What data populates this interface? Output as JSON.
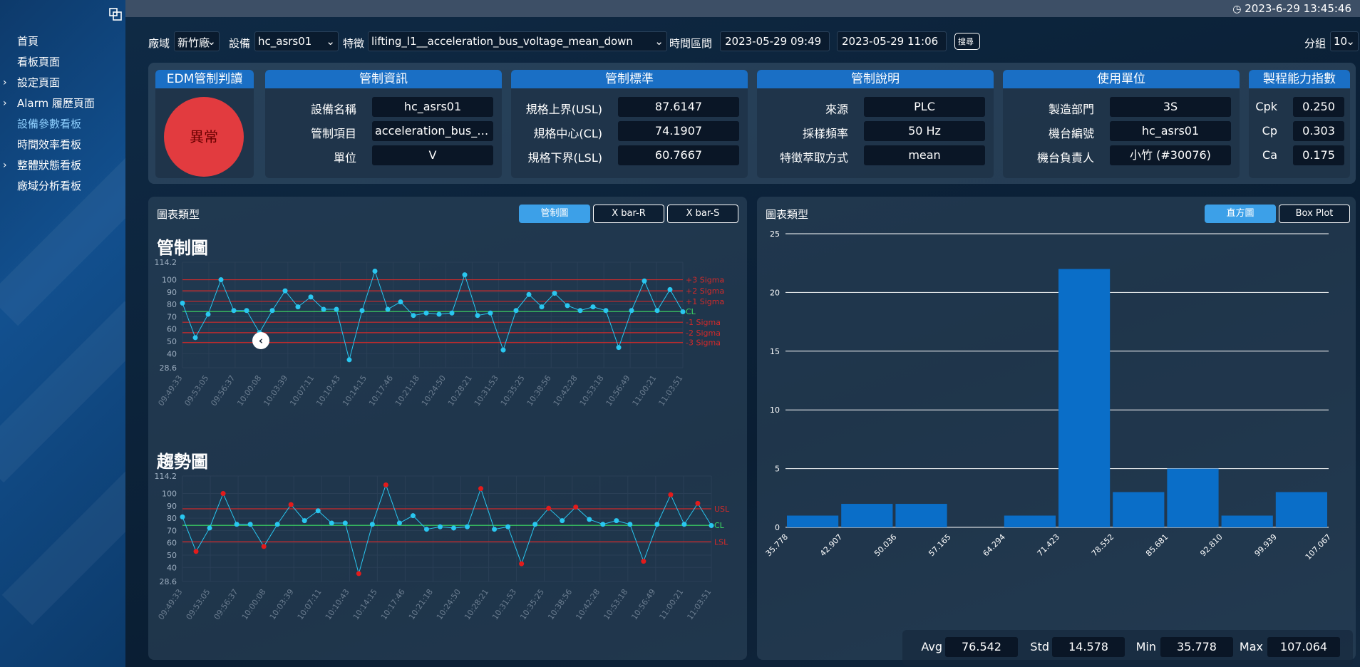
{
  "clock": "2023-6-29 13:45:46",
  "nav": {
    "items": [
      {
        "label": "首頁",
        "expandable": false
      },
      {
        "label": "看板頁面",
        "expandable": false
      },
      {
        "label": "設定頁面",
        "expandable": true
      },
      {
        "label": "Alarm 履歷頁面",
        "expandable": true
      },
      {
        "label": "設備參數看板",
        "expandable": false,
        "active": true
      },
      {
        "label": "時間效率看板",
        "expandable": false
      },
      {
        "label": "整體狀態看板",
        "expandable": true
      },
      {
        "label": "廠域分析看板",
        "expandable": false
      }
    ]
  },
  "filters": {
    "site_label": "廠域",
    "site_value": "新竹廠",
    "device_label": "設備",
    "device_value": "hc_asrs01",
    "feature_label": "特徵",
    "feature_value": "lifting_l1__acceleration_bus_voltage_mean_down",
    "time_label": "時間區間",
    "start": "2023-05-29 09:49",
    "end": "2023-05-29 11:06",
    "search": "搜尋",
    "group_label": "分組",
    "group_value": "10"
  },
  "edm": {
    "title": "EDM管制判讀",
    "status": "異常"
  },
  "control_info": {
    "title": "管制資訊",
    "rows": [
      {
        "k": "設備名稱",
        "v": "hc_asrs01"
      },
      {
        "k": "管制項目",
        "v": "acceleration_bus_voltage_mean_down"
      },
      {
        "k": "單位",
        "v": "V"
      }
    ]
  },
  "control_std": {
    "title": "管制標準",
    "rows": [
      {
        "k": "規格上界(USL)",
        "v": "87.6147"
      },
      {
        "k": "規格中心(CL)",
        "v": "74.1907"
      },
      {
        "k": "規格下界(LSL)",
        "v": "60.7667"
      }
    ]
  },
  "control_desc": {
    "title": "管制說明",
    "rows": [
      {
        "k": "來源",
        "v": "PLC"
      },
      {
        "k": "採樣頻率",
        "v": "50 Hz"
      },
      {
        "k": "特徵萃取方式",
        "v": "mean"
      }
    ]
  },
  "unit_info": {
    "title": "使用單位",
    "rows": [
      {
        "k": "製造部門",
        "v": "3S"
      },
      {
        "k": "機台編號",
        "v": "hc_asrs01"
      },
      {
        "k": "機台負責人",
        "v": "小竹 (#30076)"
      }
    ]
  },
  "capability": {
    "title": "製程能力指數",
    "rows": [
      {
        "k": "Cpk",
        "v": "0.250"
      },
      {
        "k": "Cp",
        "v": "0.303"
      },
      {
        "k": "Ca",
        "v": "0.175"
      }
    ]
  },
  "left_panel": {
    "type_label": "圖表類型",
    "buttons": [
      "管制圖",
      "X bar-R",
      "X bar-S"
    ],
    "active": 0,
    "control_title": "管制圖",
    "trend_title": "趨勢圖"
  },
  "right_panel": {
    "type_label": "圖表類型",
    "buttons": [
      "直方圖",
      "Box Plot"
    ],
    "active": 0
  },
  "stats": [
    {
      "k": "Avg",
      "v": "76.542"
    },
    {
      "k": "Std",
      "v": "14.578"
    },
    {
      "k": "Min",
      "v": "35.778"
    },
    {
      "k": "Max",
      "v": "107.064"
    }
  ],
  "chart_data": [
    {
      "type": "line",
      "title": "管制圖",
      "ylim": [
        28.6,
        114.2
      ],
      "y_ticks": [
        "114.2",
        "100",
        "90",
        "80",
        "70",
        "60",
        "50",
        "40",
        "28.6"
      ],
      "x_ticks": [
        "09:49:33",
        "09:53:05",
        "09:56:37",
        "10:00:08",
        "10:03:39",
        "10:07:11",
        "10:10:43",
        "10:14:15",
        "10:17:46",
        "10:21:18",
        "10:24:50",
        "10:28:21",
        "10:31:53",
        "10:35:25",
        "10:38:56",
        "10:42:28",
        "10:53:18",
        "10:56:49",
        "11:00:21",
        "11:03:51"
      ],
      "values": [
        81,
        53,
        72,
        100,
        75,
        75,
        57,
        75,
        91,
        78,
        86,
        76,
        76,
        35,
        75,
        107,
        76,
        82,
        71,
        73,
        72,
        73,
        104,
        71,
        73,
        43,
        75,
        88,
        78,
        89,
        79,
        75,
        78,
        75,
        45,
        75,
        99,
        75,
        92,
        74
      ],
      "lines": [
        {
          "label": "+3 Sigma",
          "value": 100,
          "color": "#d12a2a"
        },
        {
          "label": "+2 Sigma",
          "value": 91,
          "color": "#d12a2a"
        },
        {
          "label": "+1 Sigma",
          "value": 82.5,
          "color": "#d12a2a"
        },
        {
          "label": "CL",
          "value": 74.19,
          "color": "#3ddc64"
        },
        {
          "label": "-1 Sigma",
          "value": 65.5,
          "color": "#d12a2a"
        },
        {
          "label": "-2 Sigma",
          "value": 57,
          "color": "#d12a2a"
        },
        {
          "label": "-3 Sigma",
          "value": 49,
          "color": "#d12a2a"
        }
      ]
    },
    {
      "type": "line",
      "title": "趨勢圖",
      "ylim": [
        28.6,
        114.2
      ],
      "y_ticks": [
        "114.2",
        "100",
        "90",
        "80",
        "70",
        "60",
        "50",
        "40",
        "28.6"
      ],
      "x_ticks": [
        "09:49:33",
        "09:53:05",
        "09:56:37",
        "10:00:08",
        "10:03:39",
        "10:07:11",
        "10:10:43",
        "10:14:15",
        "10:17:46",
        "10:21:18",
        "10:24:50",
        "10:28:21",
        "10:31:53",
        "10:35:25",
        "10:38:56",
        "10:42:28",
        "10:53:18",
        "10:56:49",
        "11:00:21",
        "11:03:51"
      ],
      "values": [
        81,
        53,
        72,
        100,
        75,
        75,
        57,
        75,
        91,
        78,
        86,
        76,
        76,
        35,
        75,
        107,
        76,
        82,
        71,
        73,
        72,
        73,
        104,
        71,
        73,
        43,
        75,
        88,
        78,
        89,
        79,
        75,
        78,
        75,
        45,
        75,
        99,
        75,
        92,
        74
      ],
      "lines": [
        {
          "label": "USL",
          "value": 87.6147,
          "color": "#d12a2a"
        },
        {
          "label": "CL",
          "value": 74.1907,
          "color": "#3ddc64"
        },
        {
          "label": "LSL",
          "value": 60.7667,
          "color": "#d12a2a"
        }
      ],
      "normal_color": "#29c7f0",
      "out_color": "#e31b1b"
    },
    {
      "type": "bar",
      "title": "",
      "categories": [
        "35.778",
        "42.907",
        "50.036",
        "57.165",
        "64.294",
        "71.423",
        "78.552",
        "85.681",
        "92.810",
        "99.939"
      ],
      "x_edges": [
        "35.778",
        "42.907",
        "50.036",
        "57.165",
        "64.294",
        "71.423",
        "78.552",
        "85.681",
        "92.810",
        "99.939",
        "107.067"
      ],
      "values": [
        1,
        2,
        2,
        0,
        1,
        22,
        3,
        5,
        1,
        3
      ],
      "ylim": [
        0,
        25
      ],
      "y_ticks": [
        "25",
        "20",
        "15",
        "10",
        "5",
        "0"
      ],
      "grid": true,
      "color": "#0a6ec8"
    }
  ]
}
